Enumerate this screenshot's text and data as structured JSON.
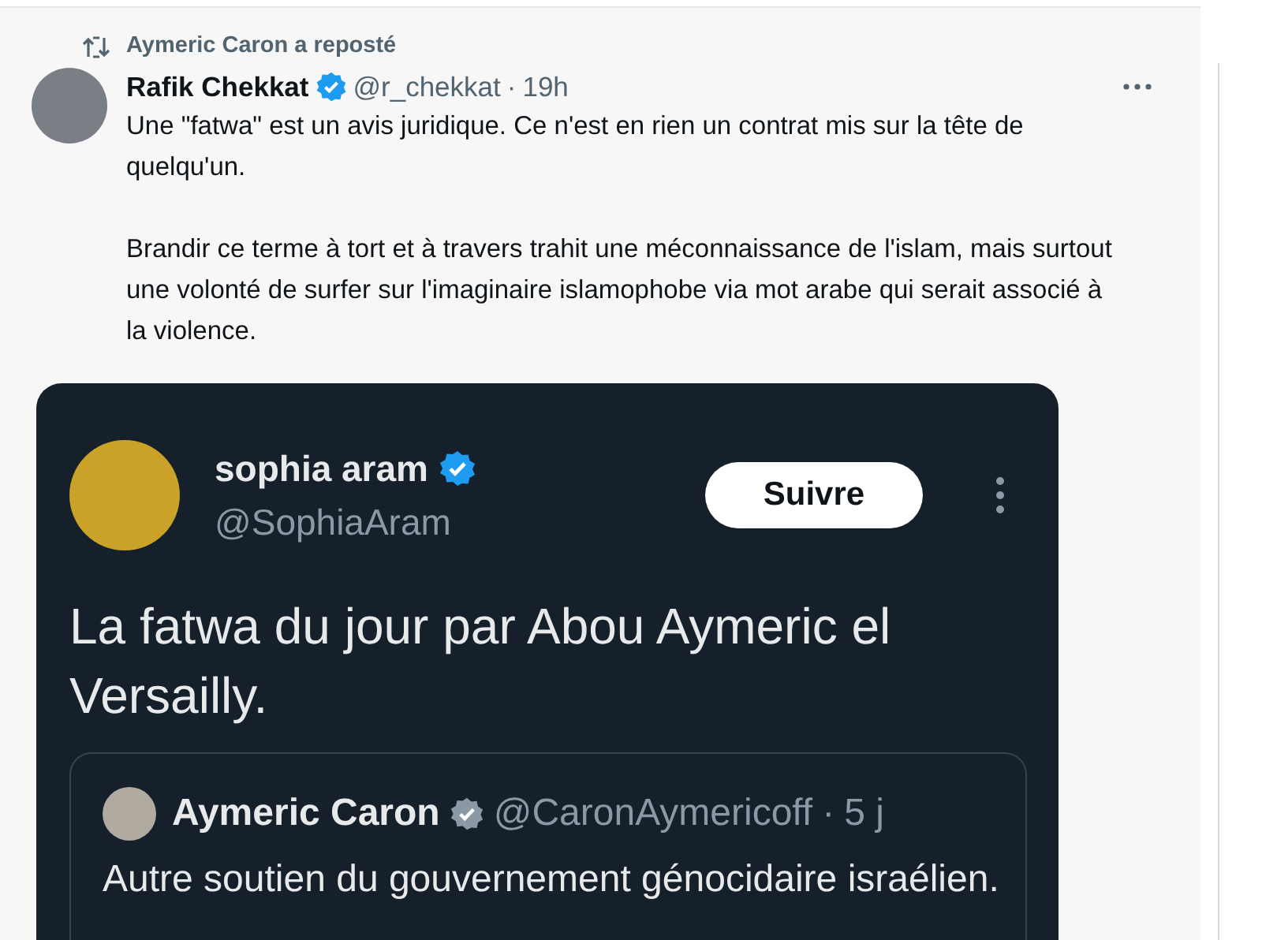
{
  "repost": {
    "text": "Aymeric Caron a reposté"
  },
  "tweet": {
    "author": "Rafik Chekkat",
    "verified": true,
    "handle": "@r_chekkat",
    "separator": "·",
    "time": "19h",
    "paragraphs": [
      "Une \"fatwa\" est un avis juridique. Ce n'est en rien un contrat mis sur la tête de quelqu'un.",
      "Brandir ce terme à tort et à travers trahit une méconnaissance de l'islam, mais surtout une volonté de surfer sur l'imaginaire islamophobe via mot arabe qui serait associé à la violence."
    ],
    "embedded_screenshot": {
      "author": "sophia aram",
      "verified": true,
      "handle": "@SophiaAram",
      "follow_button": "Suivre",
      "text": "La fatwa du jour par Abou Aymeric el Versailly.",
      "quoted": {
        "author": "Aymeric Caron",
        "verified": true,
        "handle": "@CaronAymericoff",
        "separator": "·",
        "time": "5 j",
        "text": "Autre soutien du gouvernement génocidaire israélien."
      }
    }
  }
}
